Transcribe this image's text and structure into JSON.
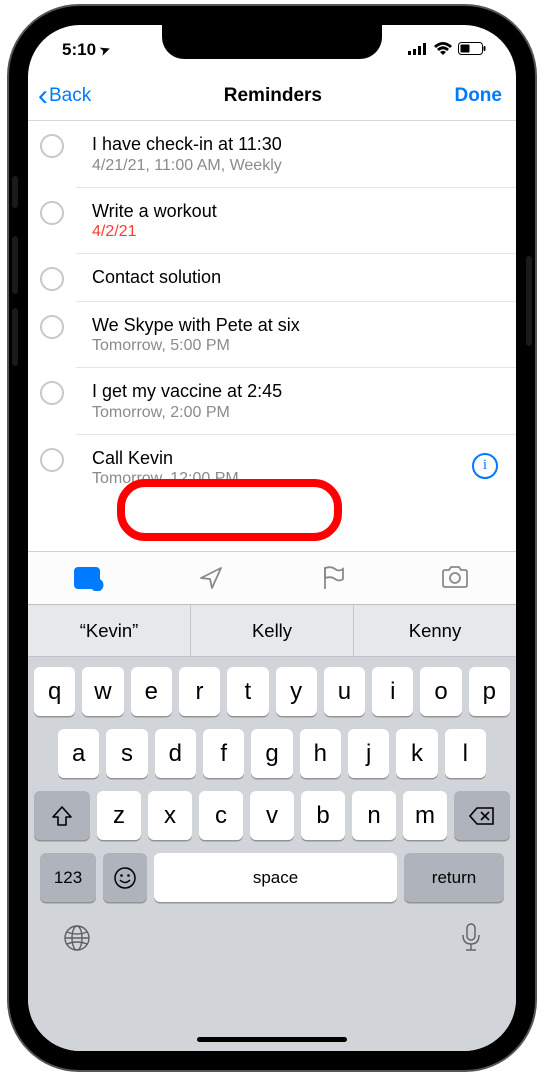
{
  "status": {
    "time": "5:10",
    "location_arrow": "➤"
  },
  "nav": {
    "back": "Back",
    "title": "Reminders",
    "done": "Done"
  },
  "reminders": [
    {
      "title": "I have check-in at 11:30",
      "subtitle": "4/21/21, 11:00 AM, Weekly",
      "overdue": false
    },
    {
      "title": "Write a workout",
      "subtitle": "4/2/21",
      "overdue": true
    },
    {
      "title": "Contact solution",
      "subtitle": "",
      "overdue": false
    },
    {
      "title": "We Skype with Pete at six",
      "subtitle": "Tomorrow, 5:00 PM",
      "overdue": false
    },
    {
      "title": "I get my vaccine at 2:45",
      "subtitle": "Tomorrow, 2:00 PM",
      "overdue": false
    },
    {
      "title": "Call Kevin",
      "subtitle": "Tomorrow, 12:00 PM",
      "overdue": false,
      "editing": true
    }
  ],
  "predictions": [
    "“Kevin”",
    "Kelly",
    "Kenny"
  ],
  "keyboard": {
    "row1": [
      "q",
      "w",
      "e",
      "r",
      "t",
      "y",
      "u",
      "i",
      "o",
      "p"
    ],
    "row2": [
      "a",
      "s",
      "d",
      "f",
      "g",
      "h",
      "j",
      "k",
      "l"
    ],
    "row3": [
      "z",
      "x",
      "c",
      "v",
      "b",
      "n",
      "m"
    ],
    "numkey": "123",
    "space": "space",
    "return": "return"
  }
}
